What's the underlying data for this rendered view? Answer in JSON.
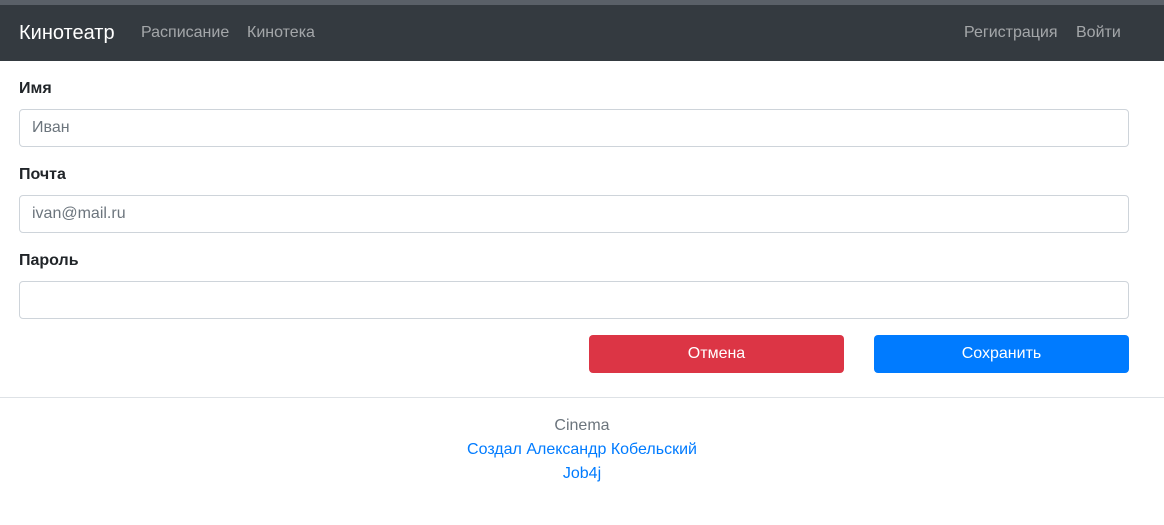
{
  "navbar": {
    "brand": "Кинотеатр",
    "links": {
      "schedule": "Расписание",
      "library": "Кинотека",
      "register": "Регистрация",
      "login": "Войти"
    }
  },
  "form": {
    "name": {
      "label": "Имя",
      "placeholder": "Иван",
      "value": ""
    },
    "email": {
      "label": "Почта",
      "placeholder": "ivan@mail.ru",
      "value": ""
    },
    "password": {
      "label": "Пароль",
      "placeholder": "",
      "value": ""
    },
    "cancel_label": "Отмена",
    "save_label": "Сохранить"
  },
  "footer": {
    "brand": "Cinema",
    "author_link": "Создал Александр Кобельский",
    "job_link": "Job4j"
  },
  "colors": {
    "navbar_bg": "#343a40",
    "cancel": "#dc3545",
    "primary": "#007bff"
  }
}
